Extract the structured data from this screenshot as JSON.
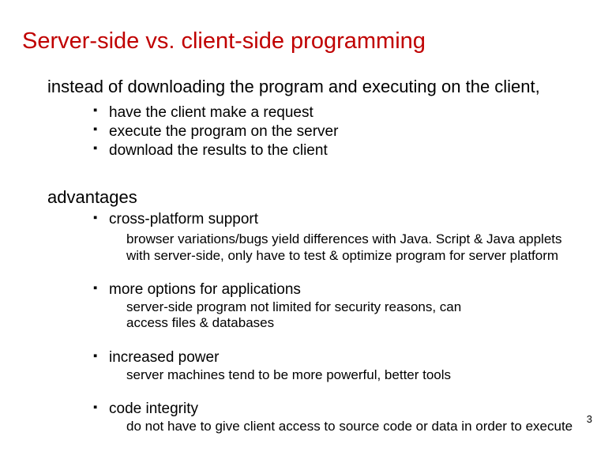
{
  "title": "Server-side vs. client-side programming",
  "lead": "instead of downloading the program and executing on the client,",
  "bullets": [
    "have the client make a request",
    "execute the program on the server",
    "download the results to the client"
  ],
  "adv_head": "advantages",
  "advantages": [
    {
      "label": "cross-platform support",
      "subs": [
        "browser variations/bugs yield differences with Java. Script & Java applets",
        "with server-side, only have to test & optimize program for server platform"
      ]
    },
    {
      "label": "more options for applications",
      "subs": [
        "server-side program not limited for security reasons, can access files & databases"
      ]
    },
    {
      "label": "increased power",
      "subs": [
        "server machines tend to be more powerful, better tools"
      ]
    },
    {
      "label": "code integrity",
      "subs": [
        "do not have to give client access to source code or data in order to execute"
      ]
    }
  ],
  "page": "3"
}
